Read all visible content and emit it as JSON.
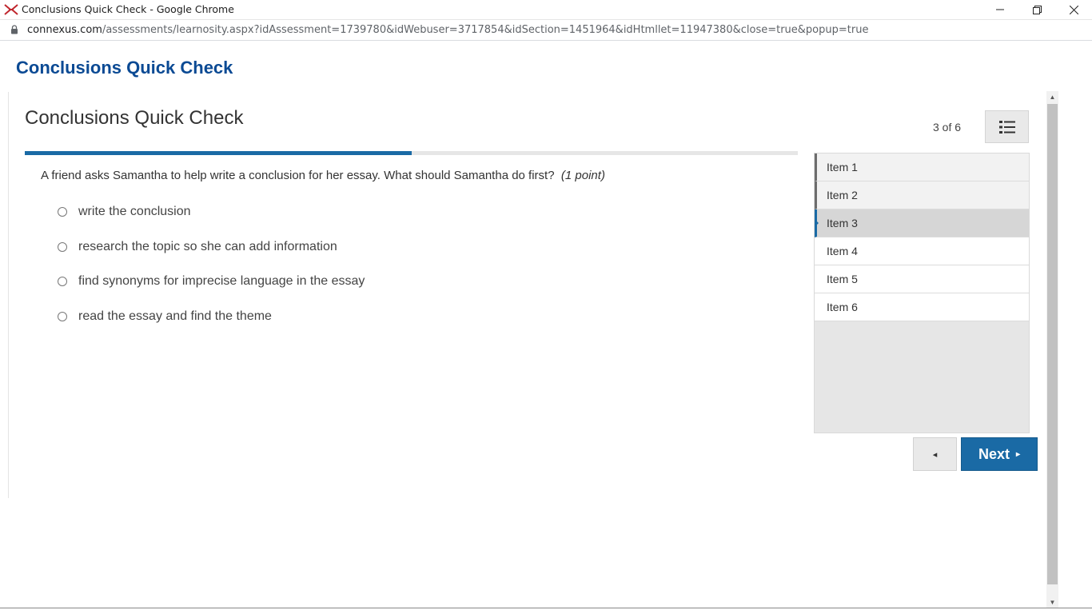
{
  "window": {
    "title": "Conclusions Quick Check - Google Chrome",
    "minimize_icon": "minimize-icon",
    "restore_icon": "restore-icon",
    "close_icon": "close-icon"
  },
  "address": {
    "host": "connexus.com",
    "path": "/assessments/learnosity.aspx?idAssessment=1739780&idWebuser=3717854&idSection=1451964&idHtmllet=11947380&close=true&popup=true"
  },
  "page": {
    "heading": "Conclusions Quick Check"
  },
  "assessment": {
    "title": "Conclusions Quick Check",
    "counter": "3 of 6",
    "progress_fraction": 0.5,
    "question": "A friend asks Samantha to help write a conclusion for her essay.  What should Samantha do first?",
    "points": "(1 point)",
    "options": [
      "write the conclusion",
      "research the topic so she can add information",
      "find synonyms for imprecise language in the essay",
      "read the essay and find the theme"
    ]
  },
  "items": [
    {
      "label": "Item 1",
      "state": "visited"
    },
    {
      "label": "Item 2",
      "state": "visited"
    },
    {
      "label": "Item 3",
      "state": "current"
    },
    {
      "label": "Item 4",
      "state": "unvisited"
    },
    {
      "label": "Item 5",
      "state": "unvisited"
    },
    {
      "label": "Item 6",
      "state": "unvisited"
    }
  ],
  "nav": {
    "prev_symbol": "◂",
    "next_label": "Next",
    "next_symbol": "▸"
  },
  "colors": {
    "accent": "#1a6aa5",
    "heading": "#0b4a94"
  }
}
